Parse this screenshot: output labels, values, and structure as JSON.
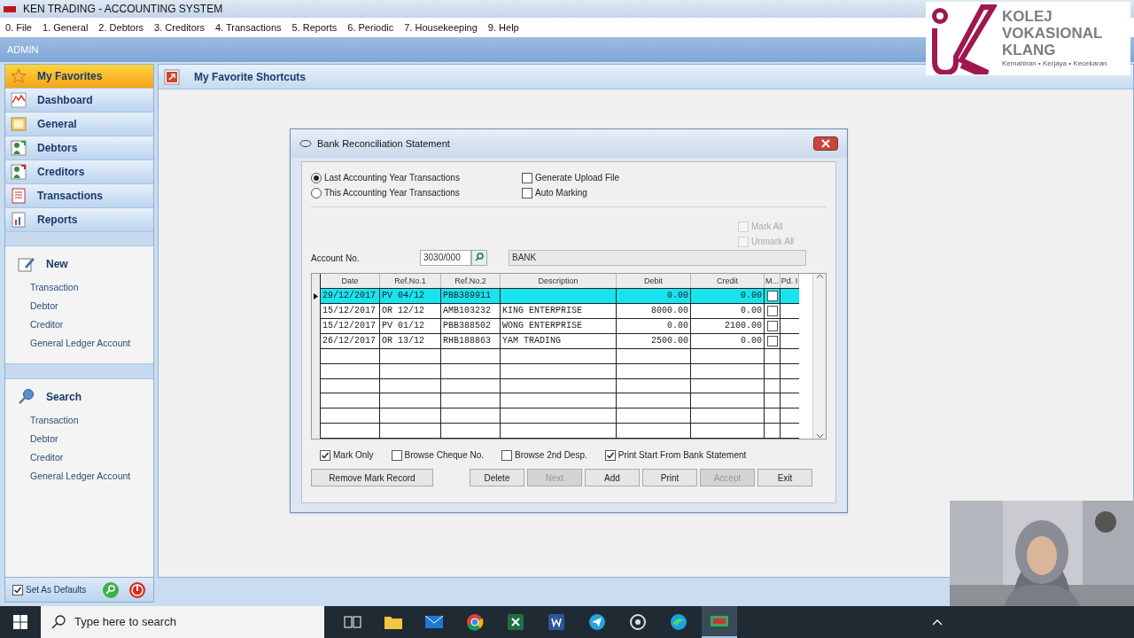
{
  "window": {
    "title": "KEN TRADING - ACCOUNTING SYSTEM"
  },
  "menu": [
    "0. File",
    "1. General",
    "2. Debtors",
    "3. Creditors",
    "4. Transactions",
    "5. Reports",
    "6. Periodic",
    "7. Housekeeping",
    "9. Help"
  ],
  "user": "ADMIN",
  "logo": {
    "lines": [
      "KOLEJ",
      "VOKASIONAL",
      "KLANG"
    ],
    "tagline": "Kemahiran • Kerjaya • Kecekaran"
  },
  "sidebar": {
    "items": [
      {
        "label": "My Favorites",
        "kind": "star",
        "selected": true
      },
      {
        "label": "Dashboard",
        "kind": "chart",
        "selected": false
      },
      {
        "label": "General",
        "kind": "gl",
        "selected": false
      },
      {
        "label": "Debtors",
        "kind": "debtor",
        "selected": false
      },
      {
        "label": "Creditors",
        "kind": "creditor",
        "selected": false
      },
      {
        "label": "Transactions",
        "kind": "doc",
        "selected": false
      },
      {
        "label": "Reports",
        "kind": "report",
        "selected": false
      }
    ],
    "new": {
      "title": "New",
      "links": [
        "Transaction",
        "Debtor",
        "Creditor",
        "General Ledger Account"
      ]
    },
    "search": {
      "title": "Search",
      "links": [
        "Transaction",
        "Debtor",
        "Creditor",
        "General Ledger Account"
      ]
    },
    "footer": {
      "label": "Set As Defaults",
      "checked": true
    }
  },
  "content": {
    "title": "My Favorite Shortcuts"
  },
  "dialog": {
    "title": "Bank Reconciliation Statement",
    "periods": [
      {
        "label": "Last Accounting Year Transactions",
        "selected": true
      },
      {
        "label": "This Accounting Year Transactions",
        "selected": false
      }
    ],
    "options": [
      {
        "label": "Generate Upload File",
        "checked": false
      },
      {
        "label": "Auto Marking",
        "checked": false
      }
    ],
    "mark_options": [
      {
        "label": "Mark All",
        "checked": false
      },
      {
        "label": "Unmark All",
        "checked": false
      }
    ],
    "account_label": "Account No.",
    "account_no": "3030/000",
    "account_name": "BANK",
    "columns": [
      "Date",
      "Ref.No.1",
      "Ref.No.2",
      "Description",
      "Debit",
      "Credit",
      "M...",
      "Pd. I"
    ],
    "rows": [
      {
        "selected": true,
        "cells": [
          "29/12/2017",
          "PV 04/12",
          "PBB389911",
          "",
          "0.00",
          "0.00"
        ],
        "marked": false
      },
      {
        "selected": false,
        "cells": [
          "15/12/2017",
          "OR 12/12",
          "AMB103232",
          "KING ENTERPRISE",
          "8000.00",
          "0.00"
        ],
        "marked": false
      },
      {
        "selected": false,
        "cells": [
          "15/12/2017",
          "PV 01/12",
          "PBB388502",
          "WONG ENTERPRISE",
          "0.00",
          "2100.00"
        ],
        "marked": false
      },
      {
        "selected": false,
        "cells": [
          "26/12/2017",
          "OR 13/12",
          "RHB188863",
          "YAM TRADING",
          "2500.00",
          "0.00"
        ],
        "marked": false
      }
    ],
    "bottom_options": [
      {
        "label": "Mark Only",
        "checked": true
      },
      {
        "label": "Browse Cheque No.",
        "checked": false
      },
      {
        "label": "Browse 2nd Desp.",
        "checked": false
      },
      {
        "label": "Print Start From Bank Statement",
        "checked": true
      }
    ],
    "buttons": [
      {
        "label": "Remove Mark Record",
        "disabled": false
      },
      {
        "label": "Delete",
        "disabled": false
      },
      {
        "label": "Next",
        "disabled": true
      },
      {
        "label": "Add",
        "disabled": false
      },
      {
        "label": "Print",
        "disabled": false
      },
      {
        "label": "Accept",
        "disabled": true
      },
      {
        "label": "Exit",
        "disabled": false
      }
    ]
  },
  "taskbar": {
    "search_placeholder": "Type here to search"
  }
}
